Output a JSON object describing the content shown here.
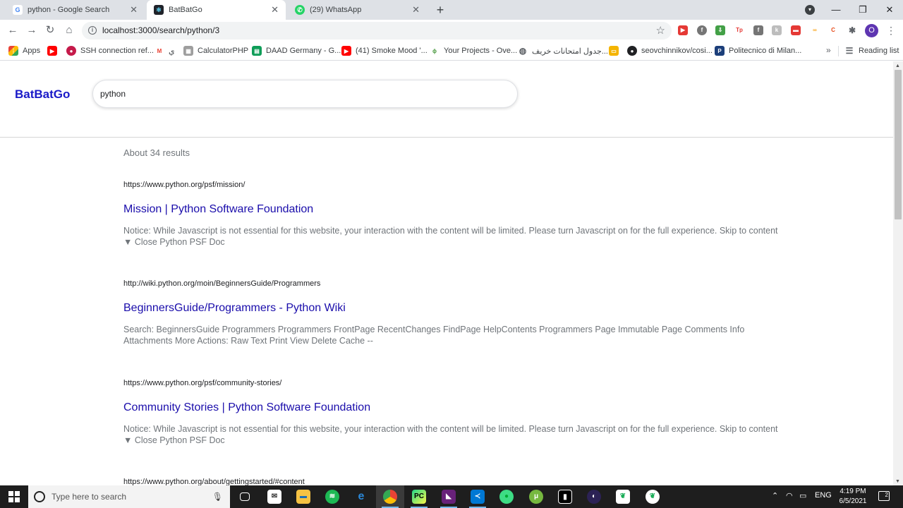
{
  "browser": {
    "tabs": [
      {
        "title": "python - Google Search",
        "favicon": "google-icon",
        "active": false
      },
      {
        "title": "BatBatGo",
        "favicon": "react-icon",
        "active": true
      },
      {
        "title": "(29) WhatsApp",
        "favicon": "whatsapp-icon",
        "active": false
      }
    ],
    "url": "localhost:3000/search/python/3",
    "bookmarks": [
      {
        "label": "Apps",
        "icon": "apps-grid-icon",
        "color": "#ea4335"
      },
      {
        "label": "",
        "icon": "youtube-icon",
        "color": "#ff0000"
      },
      {
        "label": "SSH connection ref...",
        "icon": "raspberry-icon",
        "color": "#c51a4a"
      },
      {
        "label": "ي",
        "icon": "gmail-icon",
        "color": "#ea4335"
      },
      {
        "label": "CalculatorPHP",
        "icon": "calculator-icon",
        "color": "#888888"
      },
      {
        "label": "DAAD Germany - G...",
        "icon": "sheets-icon",
        "color": "#0f9d58"
      },
      {
        "label": "(41) Smoke Mood '...",
        "icon": "youtube-icon",
        "color": "#ff0000"
      },
      {
        "label": "Your Projects - Ove...",
        "icon": "overleaf-icon",
        "color": "#4f9c45"
      },
      {
        "label": "جدول امتحانات خريف...",
        "icon": "globe-icon",
        "color": "#5f6368"
      },
      {
        "label": "",
        "icon": "slides-icon",
        "color": "#f4b400"
      },
      {
        "label": "seovchinnikov/cosi...",
        "icon": "github-icon",
        "color": "#202124"
      },
      {
        "label": "Politecnico di Milan...",
        "icon": "polimi-icon",
        "color": "#1c3f7a"
      }
    ],
    "reading_list": "Reading list"
  },
  "app": {
    "logo": "BatBatGo",
    "search_value": "python",
    "results_count": "About 34 results",
    "results": [
      {
        "url": "https://www.python.org/psf/mission/",
        "title": "Mission | Python Software Foundation",
        "snippet": "Notice: While Javascript is not essential for this website, your interaction with the content will be limited. Please turn Javascript on for the full experience. Skip to content ▼ Close Python PSF Doc"
      },
      {
        "url": "http://wiki.python.org/moin/BeginnersGuide/Programmers",
        "title": "BeginnersGuide/Programmers - Python Wiki",
        "snippet": "Search: BeginnersGuide Programmers Programmers FrontPage RecentChanges FindPage HelpContents Programmers Page Immutable Page Comments Info Attachments More Actions: Raw Text Print View Delete Cache --"
      },
      {
        "url": "https://www.python.org/psf/community-stories/",
        "title": "Community Stories | Python Software Foundation",
        "snippet": "Notice: While Javascript is not essential for this website, your interaction with the content will be limited. Please turn Javascript on for the full experience. Skip to content ▼ Close Python PSF Doc"
      },
      {
        "url": "https://www.python.org/about/gettingstarted/#content",
        "title": "",
        "snippet": ""
      }
    ]
  },
  "taskbar": {
    "search_placeholder": "Type here to search",
    "language": "ENG",
    "time": "4:19 PM",
    "date": "6/5/2021",
    "notification_count": "2"
  },
  "colors": {
    "logo": "#1a1ac8",
    "result_title": "#1a0dab",
    "snippet": "#70757a"
  }
}
